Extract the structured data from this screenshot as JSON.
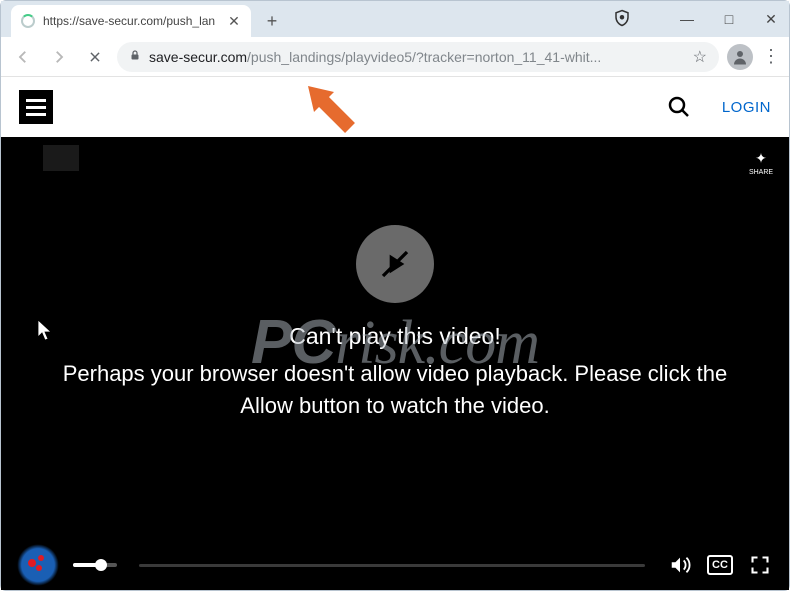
{
  "window": {
    "minimize": "—",
    "maximize": "□",
    "close": "✕"
  },
  "tab": {
    "title": "https://save-secur.com/push_lan",
    "close": "✕"
  },
  "newtab": "+",
  "url": {
    "domain": "save-secur.com",
    "path": "/push_landings/playvideo5/?tracker=norton_11_41-whit..."
  },
  "siteheader": {
    "login": "LOGIN"
  },
  "video": {
    "share": "SHARE",
    "heading": "Can't play this video!",
    "body": "Perhaps your browser doesn't allow video playback. Please click the Allow button to watch the video.",
    "cc": "CC"
  },
  "watermark": "PCrisk.com"
}
